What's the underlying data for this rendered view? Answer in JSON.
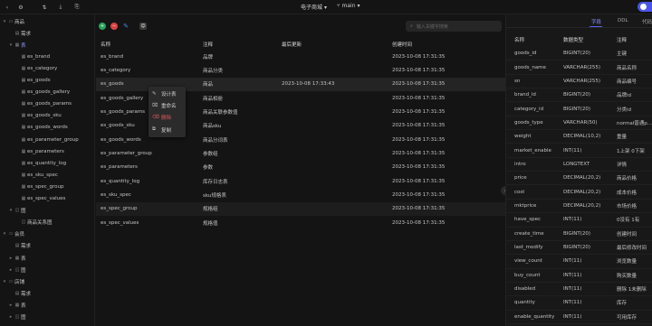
{
  "topbar": {
    "title": "电子商城",
    "branch": "main",
    "title_arrow": "▾",
    "branch_arrow": "▾"
  },
  "sidebar": {
    "items": [
      {
        "label": "商品",
        "depth": 0,
        "twisty": "▾",
        "icon": "folder-icon",
        "glyph": "▭"
      },
      {
        "label": "需求",
        "depth": 1,
        "twisty": "",
        "icon": "doc-icon",
        "glyph": "▤"
      },
      {
        "label": "表",
        "depth": 1,
        "twisty": "▾",
        "icon": "table-group-icon",
        "glyph": "▦",
        "active": true
      },
      {
        "label": "es_brand",
        "depth": 2,
        "twisty": "",
        "icon": "table-icon",
        "glyph": "▦"
      },
      {
        "label": "es_category",
        "depth": 2,
        "twisty": "",
        "icon": "table-icon",
        "glyph": "▦"
      },
      {
        "label": "es_goods",
        "depth": 2,
        "twisty": "",
        "icon": "table-icon",
        "glyph": "▦"
      },
      {
        "label": "es_goods_gallery",
        "depth": 2,
        "twisty": "",
        "icon": "table-icon",
        "glyph": "▦"
      },
      {
        "label": "es_goods_params",
        "depth": 2,
        "twisty": "",
        "icon": "table-icon",
        "glyph": "▦"
      },
      {
        "label": "es_goods_sku",
        "depth": 2,
        "twisty": "",
        "icon": "table-icon",
        "glyph": "▦"
      },
      {
        "label": "es_goods_words",
        "depth": 2,
        "twisty": "",
        "icon": "table-icon",
        "glyph": "▦"
      },
      {
        "label": "es_parameter_group",
        "depth": 2,
        "twisty": "",
        "icon": "table-icon",
        "glyph": "▦"
      },
      {
        "label": "es_parameters",
        "depth": 2,
        "twisty": "",
        "icon": "table-icon",
        "glyph": "▦"
      },
      {
        "label": "es_quantity_log",
        "depth": 2,
        "twisty": "",
        "icon": "table-icon",
        "glyph": "▦"
      },
      {
        "label": "es_sku_spec",
        "depth": 2,
        "twisty": "",
        "icon": "table-icon",
        "glyph": "▦"
      },
      {
        "label": "es_spec_group",
        "depth": 2,
        "twisty": "",
        "icon": "table-icon",
        "glyph": "▦"
      },
      {
        "label": "es_spec_values",
        "depth": 2,
        "twisty": "",
        "icon": "table-icon",
        "glyph": "▦"
      },
      {
        "label": "图",
        "depth": 1,
        "twisty": "▾",
        "icon": "diagram-group-icon",
        "glyph": "◫"
      },
      {
        "label": "商品关系图",
        "depth": 2,
        "twisty": "",
        "icon": "diagram-icon",
        "glyph": "◫"
      },
      {
        "label": "会员",
        "depth": 0,
        "twisty": "▾",
        "icon": "folder-icon",
        "glyph": "▭"
      },
      {
        "label": "需求",
        "depth": 1,
        "twisty": "",
        "icon": "doc-icon",
        "glyph": "▤"
      },
      {
        "label": "表",
        "depth": 1,
        "twisty": "▸",
        "icon": "table-group-icon",
        "glyph": "▦"
      },
      {
        "label": "图",
        "depth": 1,
        "twisty": "▸",
        "icon": "diagram-group-icon",
        "glyph": "◫"
      },
      {
        "label": "店铺",
        "depth": 0,
        "twisty": "▾",
        "icon": "folder-icon",
        "glyph": "▭"
      },
      {
        "label": "需求",
        "depth": 1,
        "twisty": "",
        "icon": "doc-icon",
        "glyph": "▤"
      },
      {
        "label": "表",
        "depth": 1,
        "twisty": "▸",
        "icon": "table-group-icon",
        "glyph": "▦"
      },
      {
        "label": "图",
        "depth": 1,
        "twisty": "▸",
        "icon": "diagram-group-icon",
        "glyph": "◫"
      }
    ]
  },
  "main": {
    "search_placeholder": "输入关键字搜索",
    "search_glyph": "⌕",
    "columns": [
      "名称",
      "注释",
      "最后更新",
      "创建时间"
    ],
    "rows": [
      {
        "name": "es_brand",
        "comment": "品牌",
        "updated": "",
        "created": "2023-10-08 17:31:35"
      },
      {
        "name": "es_category",
        "comment": "商品分类",
        "updated": "",
        "created": "2023-10-08 17:31:35"
      },
      {
        "name": "es_goods",
        "comment": "商品",
        "updated": "2023-10-08 17:33:43",
        "created": "2023-10-08 17:31:35"
      },
      {
        "name": "es_goods_gallery",
        "comment": "商品相册",
        "updated": "",
        "created": "2023-10-08 17:31:35"
      },
      {
        "name": "es_goods_params",
        "comment": "商品关联参数值",
        "updated": "",
        "created": "2023-10-08 17:31:35"
      },
      {
        "name": "es_goods_sku",
        "comment": "商品sku",
        "updated": "",
        "created": "2023-10-08 17:31:35"
      },
      {
        "name": "es_goods_words",
        "comment": "商品分词表",
        "updated": "",
        "created": "2023-10-08 17:31:35"
      },
      {
        "name": "es_parameter_group",
        "comment": "参数组",
        "updated": "",
        "created": "2023-10-08 17:31:35"
      },
      {
        "name": "es_parameters",
        "comment": "参数",
        "updated": "",
        "created": "2023-10-08 17:31:35"
      },
      {
        "name": "es_quantity_log",
        "comment": "库存日志表",
        "updated": "",
        "created": "2023-10-08 17:31:35"
      },
      {
        "name": "es_sku_spec",
        "comment": "sku规格表",
        "updated": "",
        "created": "2023-10-08 17:31:35"
      },
      {
        "name": "es_spec_group",
        "comment": "规格组",
        "updated": "",
        "created": "2023-10-08 17:31:35"
      },
      {
        "name": "es_spec_values",
        "comment": "规格值",
        "updated": "",
        "created": "2023-10-08 17:31:35"
      }
    ],
    "context_menu": {
      "design": "设计表",
      "rename": "重命名",
      "delete": "删除",
      "copy": "复制"
    }
  },
  "right_panel": {
    "tabs": [
      "字段",
      "DDL",
      "代码"
    ],
    "columns": [
      "名称",
      "数据类型",
      "注释"
    ],
    "fields": [
      {
        "name": "goods_id",
        "type": "BIGINT(20)",
        "comment": "主键"
      },
      {
        "name": "goods_name",
        "type": "VARCHAR(255)",
        "comment": "商品名称"
      },
      {
        "name": "sn",
        "type": "VARCHAR(255)",
        "comment": "商品编号"
      },
      {
        "name": "brand_id",
        "type": "BIGINT(20)",
        "comment": "品牌id"
      },
      {
        "name": "category_id",
        "type": "BIGINT(20)",
        "comment": "分类id"
      },
      {
        "name": "goods_type",
        "type": "VARCHAR(50)",
        "comment": "normal普通p..."
      },
      {
        "name": "weight",
        "type": "DECIMAL(10,2)",
        "comment": "重量"
      },
      {
        "name": "market_enable",
        "type": "INT(11)",
        "comment": "1上架 0下架"
      },
      {
        "name": "intro",
        "type": "LONGTEXT",
        "comment": "详情"
      },
      {
        "name": "price",
        "type": "DECIMAL(20,2)",
        "comment": "商品价格"
      },
      {
        "name": "cost",
        "type": "DECIMAL(20,2)",
        "comment": "成本价格"
      },
      {
        "name": "mktprice",
        "type": "DECIMAL(20,2)",
        "comment": "市场价格"
      },
      {
        "name": "have_spec",
        "type": "INT(11)",
        "comment": "0没有 1有"
      },
      {
        "name": "create_time",
        "type": "BIGINT(20)",
        "comment": "创建时间"
      },
      {
        "name": "last_modify",
        "type": "BIGINT(20)",
        "comment": "最后修改时间"
      },
      {
        "name": "view_count",
        "type": "INT(11)",
        "comment": "浏览数量"
      },
      {
        "name": "buy_count",
        "type": "INT(11)",
        "comment": "购买数量"
      },
      {
        "name": "disabled",
        "type": "INT(11)",
        "comment": "删除 1未删除"
      },
      {
        "name": "quantity",
        "type": "INT(11)",
        "comment": "库存"
      },
      {
        "name": "enable_quantity",
        "type": "INT(11)",
        "comment": "可用库存"
      }
    ]
  },
  "colors": {
    "accent": "#5a64f0",
    "green": "#29a35a",
    "red": "#d94343",
    "blue": "#4a8cf0",
    "danger": "#e05a5a"
  }
}
